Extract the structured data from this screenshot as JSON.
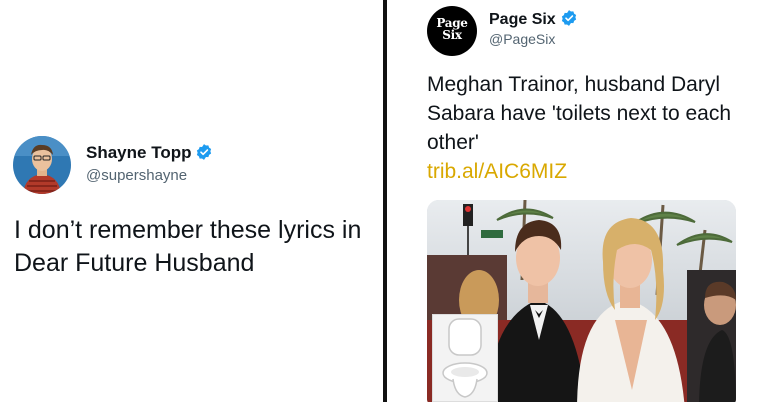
{
  "left_tweet": {
    "display_name": "Shayne Topp",
    "handle": "@supershayne",
    "text": "I don’t remember these lyrics in Dear Future Husband",
    "verified": true
  },
  "right_tweet": {
    "display_name": "Page Six",
    "handle": "@PageSix",
    "verified": true,
    "avatar_text_line1": "Page",
    "avatar_text_line2": "Six",
    "text": "Meghan Trainor, husband Daryl Sabara have 'toilets next to each other'",
    "link_text": "trib.al/AIC6MIZ"
  },
  "colors": {
    "verified_blue": "#1d9bf0",
    "link_color": "#d9a800",
    "divider": "#111111"
  },
  "icons": {
    "verified": "verified-badge-icon",
    "toilet": "toilet-icon"
  }
}
